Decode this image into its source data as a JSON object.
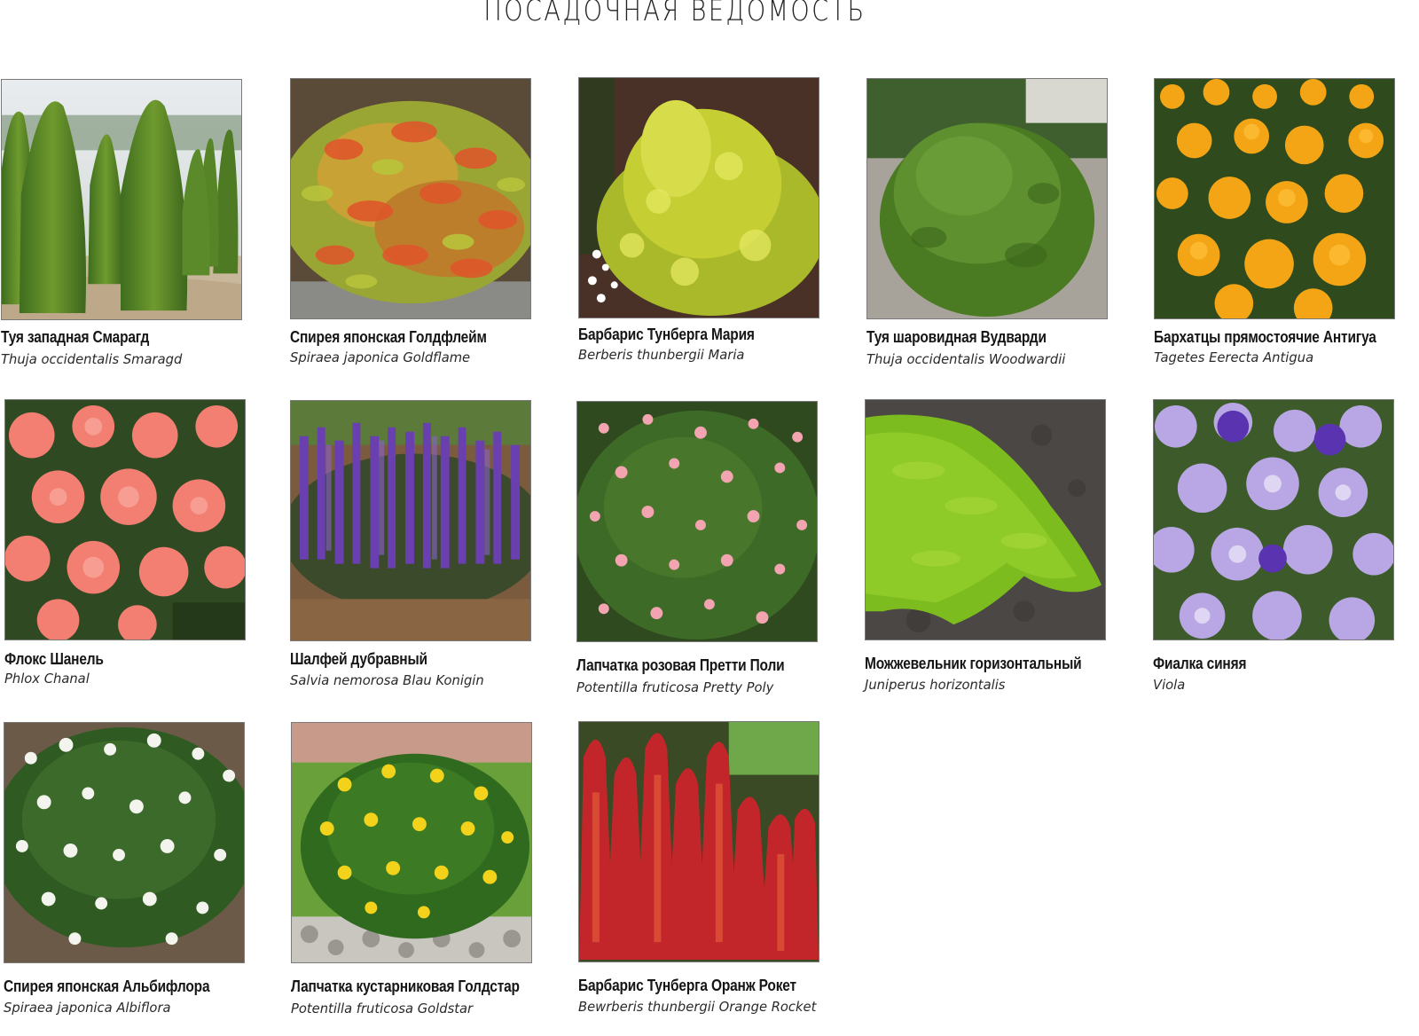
{
  "title": "ПОСАДОЧНАЯ ВЕДОМОСТЬ",
  "plants": [
    {
      "ru": "Туя западная Смарагд",
      "lat": "Thuja occidentalis Smaragd",
      "photo": "thuja-smaragd-photo"
    },
    {
      "ru": "Спирея японская Голдфлейм",
      "lat": "Spiraea japonica Goldflame",
      "photo": "spiraea-goldflame-photo"
    },
    {
      "ru": "Барбарис Тунберга Мария",
      "lat": "Berberis thunbergii Maria",
      "photo": "berberis-maria-photo"
    },
    {
      "ru": "Туя шаровидная Вудварди",
      "lat": "Thuja occidentalis Woodwardii",
      "photo": "thuja-woodwardii-photo"
    },
    {
      "ru": "Бархатцы прямостоячие Антигуа",
      "lat": "Tagetes Eerecta Antigua",
      "photo": "tagetes-antigua-photo"
    },
    {
      "ru": "Флокс Шанель",
      "lat": "Phlox Chanal",
      "photo": "phlox-chanal-photo"
    },
    {
      "ru": "Шалфей дубравный",
      "lat": "Salvia nemorosa Blau Konigin",
      "photo": "salvia-nemorosa-photo"
    },
    {
      "ru": "Лапчатка розовая Претти Поли",
      "lat": "Potentilla fruticosa Pretty Poly",
      "photo": "potentilla-pretty-poly-photo"
    },
    {
      "ru": "Можжевельник горизонтальный",
      "lat": "Juniperus horizontalis",
      "photo": "juniperus-horizontalis-photo"
    },
    {
      "ru": "Фиалка синяя",
      "lat": "Viola",
      "photo": "viola-photo"
    },
    {
      "ru": "Спирея японская Альбифлора",
      "lat": "Spiraea japonica Albiflora",
      "photo": "spiraea-albiflora-photo"
    },
    {
      "ru": "Лапчатка кустарниковая Голдстар",
      "lat": "Potentilla fruticosa Goldstar",
      "photo": "potentilla-goldstar-photo"
    },
    {
      "ru": "Барбарис Тунберга Оранж Рокет",
      "lat": "Bewrberis thunbergii Orange Rocket",
      "photo": "berberis-orange-rocket-photo"
    }
  ]
}
